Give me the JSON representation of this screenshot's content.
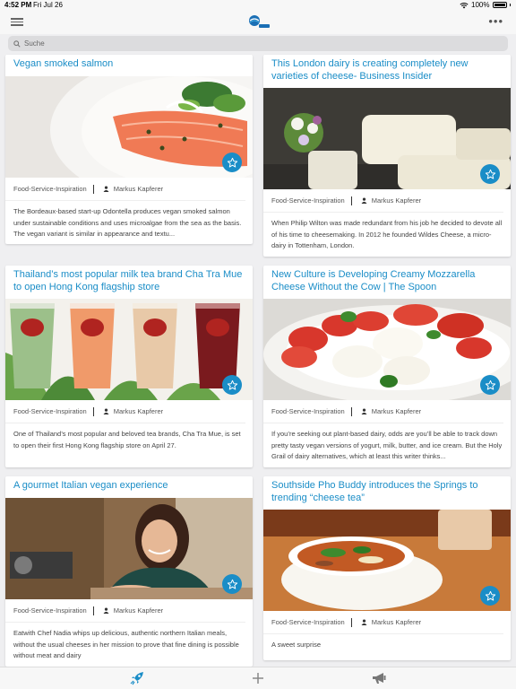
{
  "status": {
    "time": "4:52 PM",
    "date": "Fri Jul 26",
    "battery": "100%"
  },
  "search": {
    "placeholder": "Suche"
  },
  "cards": [
    {
      "title": "Vegan smoked salmon",
      "category": "Food-Service-Inspiration",
      "author": "Markus Kapferer",
      "body": "The Bordeaux-based start-up Odontella produces vegan smoked salmon under sustainable conditions and uses microalgae from the sea as the basis. The vegan variant is similar in appearance and textu..."
    },
    {
      "title": "This London dairy is creating completely new varieties of cheese- Business Insider",
      "category": "Food-Service-Inspiration",
      "author": "Markus Kapferer",
      "body": "When Philip Wilton was made redundant from his job he decided to devote all of his time to cheesemaking. In 2012 he founded Wildes Cheese, a micro-dairy in Tottenham, London."
    },
    {
      "title": "Thailand’s most popular milk tea brand Cha Tra Mue to open Hong Kong flagship store",
      "category": "Food-Service-Inspiration",
      "author": "Markus Kapferer",
      "body": "One of Thailand’s most popular and beloved tea brands, Cha Tra Mue, is set to open their first Hong Kong flagship store on April 27."
    },
    {
      "title": "New Culture is Developing Creamy Mozzarella Cheese Without the Cow | The Spoon",
      "category": "Food-Service-Inspiration",
      "author": "Markus Kapferer",
      "body": "If you’re seeking out plant-based dairy, odds are you’ll be able to track down pretty tasty vegan versions of yogurt, milk, butter, and ice cream. But the Holy Grail of dairy alternatives, which at least this writer thinks..."
    },
    {
      "title": "A gourmet Italian vegan experience",
      "category": "Food-Service-Inspiration",
      "author": "Markus Kapferer",
      "body": "Eatwith Chef Nadia whips up delicious, authentic northern Italian meals, without the usual cheeses in her mission to prove that fine dining is possible without meat and dairy"
    },
    {
      "title": "Southside Pho Buddy introduces the Springs to trending “cheese tea”",
      "category": "Food-Service-Inspiration",
      "author": "Markus Kapferer",
      "body": "A sweet surprise"
    }
  ],
  "colors": {
    "accent": "#1a8dc7",
    "background": "#efeff1"
  },
  "icons": {
    "menu": "menu-icon",
    "more": "more-icon",
    "favorite": "star-icon",
    "search": "search-icon",
    "tab1": "rocket-icon",
    "tab2": "plus-icon",
    "tab3": "megaphone-icon"
  }
}
